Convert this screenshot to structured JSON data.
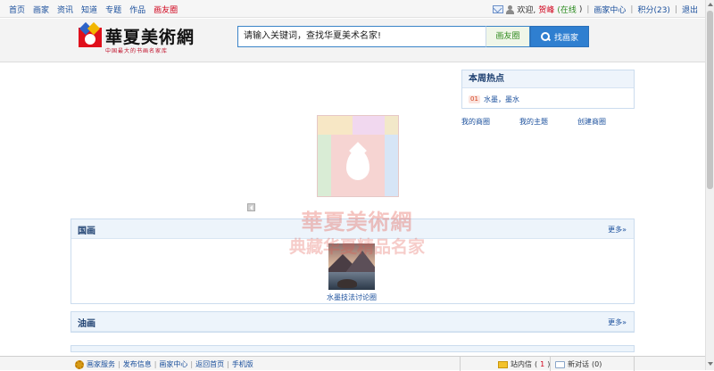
{
  "topnav": {
    "items": [
      {
        "label": "首页",
        "red": false
      },
      {
        "label": "画家",
        "red": false
      },
      {
        "label": "资讯",
        "red": false
      },
      {
        "label": "知道",
        "red": false
      },
      {
        "label": "专题",
        "red": false
      },
      {
        "label": "作品",
        "red": false
      },
      {
        "label": "画友圈",
        "red": true
      }
    ]
  },
  "userbar": {
    "welcome": "欢迎,",
    "username": "贺峰",
    "status": "(在线",
    "status_close": ")",
    "center": "画家中心",
    "points": "积分(23)",
    "logout": "退出"
  },
  "logo": {
    "title": "華夏美術網",
    "subtitle": "中国最大的书画名家库"
  },
  "search": {
    "placeholder": "请输入关键词，查找华夏美术名家!",
    "tag": "画友圈",
    "button": "找画家"
  },
  "hot": {
    "title": "本周热点",
    "items": [
      {
        "rank": "01",
        "label": "水墨，墨水"
      }
    ]
  },
  "circle_links": [
    "我的商圈",
    "我的主题",
    "创建商圈"
  ],
  "watermark": {
    "line1": "華夏美術網",
    "line2": "典藏华夏精品名家"
  },
  "sections": {
    "guohua": {
      "title": "国画",
      "more": "更多»",
      "thumb_caption": "水墨技法讨论圈"
    },
    "youhua": {
      "title": "油画",
      "more": "更多»"
    }
  },
  "bottombar": {
    "links": [
      "画家服务",
      "发布信息",
      "画家中心",
      "返回首页",
      "手机版"
    ],
    "messages_label": "站内信",
    "messages_count": "1",
    "talk_label": "新对话",
    "talk_count": "(0)"
  }
}
